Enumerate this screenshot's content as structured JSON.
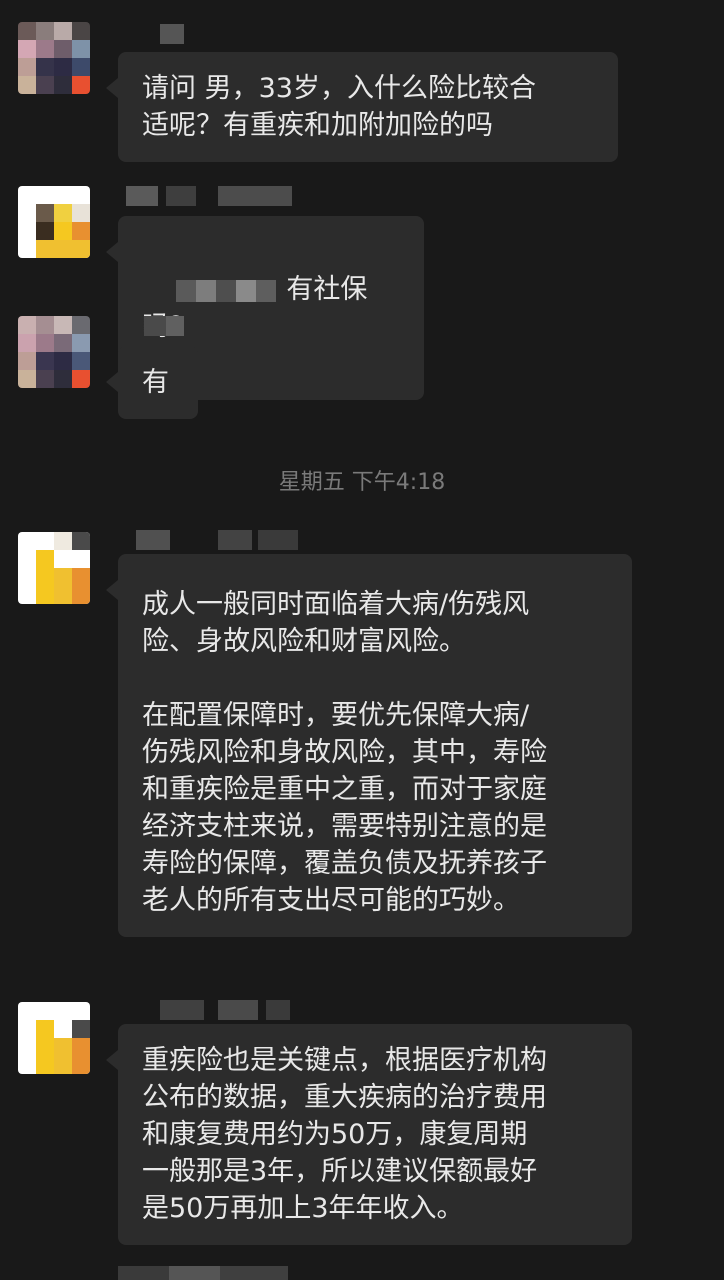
{
  "messages": [
    {
      "text": "请问 男，33岁，入什么险比较合\n适呢？有重疾和加附加险的吗"
    },
    {
      "text": "有社保吗?"
    },
    {
      "text": "有"
    },
    {
      "text": "成人一般同时面临着大病/伤残风\n险、身故风险和财富风险。\n\n在配置保障时，要优先保障大病/\n伤残风险和身故风险，其中，寿险\n和重疾险是重中之重，而对于家庭\n经济支柱来说，需要特别注意的是\n寿险的保障，覆盖负债及抚养孩子\n老人的所有支出尽可能的巧妙。"
    },
    {
      "text": "重疾险也是关键点，根据医疗机构\n公布的数据，重大疾病的治疗费用\n和康复费用约为50万，康复周期\n一般那是3年，所以建议保额最好\n是50万再加上3年年收入。"
    }
  ],
  "timestamp": "星期五 下午4:18"
}
